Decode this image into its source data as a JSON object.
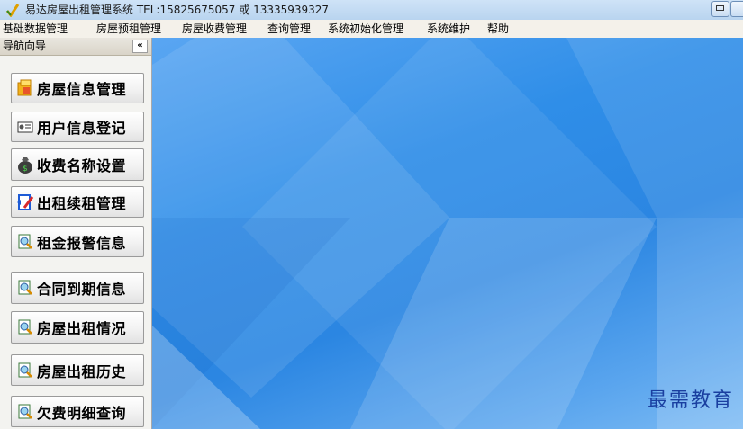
{
  "window": {
    "title": "易达房屋出租管理系统  TEL:15825675057 或 13335939327"
  },
  "menubar": {
    "items": [
      "基础数据管理",
      "房屋预租管理",
      "房屋收费管理",
      "查询管理",
      "系统初始化管理",
      "系统维护",
      "帮助"
    ]
  },
  "sidebar": {
    "title": "导航向导",
    "collapse_label": "«",
    "items": [
      {
        "label": "房屋信息管理",
        "icon": "house-folder-icon"
      },
      {
        "label": "用户信息登记",
        "icon": "id-card-icon"
      },
      {
        "label": "收费名称设置",
        "icon": "money-bag-icon"
      },
      {
        "label": "出租续租管理",
        "icon": "edit-document-icon"
      },
      {
        "label": "租金报警信息",
        "icon": "search-document-icon"
      },
      {
        "label": "合同到期信息",
        "icon": "search-document-icon"
      },
      {
        "label": "房屋出租情况",
        "icon": "search-document-icon"
      },
      {
        "label": "房屋出租历史",
        "icon": "search-document-icon"
      },
      {
        "label": "欠费明细查询",
        "icon": "search-document-icon"
      }
    ]
  },
  "main": {
    "watermark": "最需教育"
  },
  "colors": {
    "desktop_blue": "#2f8ee8",
    "watermark": "#1a3fa0"
  }
}
